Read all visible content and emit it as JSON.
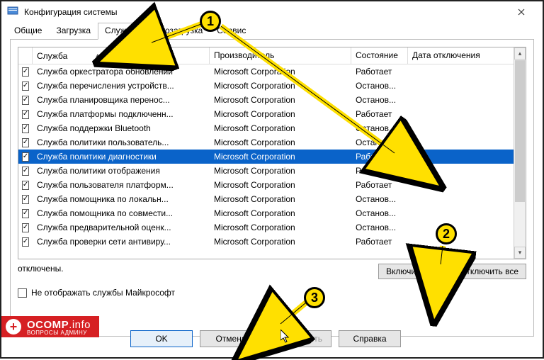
{
  "title": "Конфигурация системы",
  "tabs": [
    "Общие",
    "Загрузка",
    "Службы",
    "Автозагрузка",
    "Сервис"
  ],
  "active_tab": 2,
  "columns": {
    "name": "Служба",
    "vendor": "Производитель",
    "state": "Состояние",
    "date": "Дата отключения"
  },
  "rows": [
    {
      "checked": true,
      "name": "Служба оркестратора обновлений",
      "vendor": "Microsoft Corporation",
      "state": "Работает"
    },
    {
      "checked": true,
      "name": "Служба перечисления устройств...",
      "vendor": "Microsoft Corporation",
      "state": "Останов..."
    },
    {
      "checked": true,
      "name": "Служба планировщика перенос...",
      "vendor": "Microsoft Corporation",
      "state": "Останов..."
    },
    {
      "checked": true,
      "name": "Служба платформы подключенн...",
      "vendor": "Microsoft Corporation",
      "state": "Работает"
    },
    {
      "checked": true,
      "name": "Служба поддержки Bluetooth",
      "vendor": "Microsoft Corporation",
      "state": "Останов..."
    },
    {
      "checked": true,
      "name": "Служба политики пользователь...",
      "vendor": "Microsoft Corporation",
      "state": "Останов..."
    },
    {
      "checked": true,
      "name": "Служба политики диагностики",
      "vendor": "Microsoft Corporation",
      "state": "Работает",
      "selected": true
    },
    {
      "checked": true,
      "name": "Служба политики отображения",
      "vendor": "Microsoft Corporation",
      "state": "Работает"
    },
    {
      "checked": true,
      "name": "Служба пользователя платформ...",
      "vendor": "Microsoft Corporation",
      "state": "Работает"
    },
    {
      "checked": true,
      "name": "Служба помощника по локальн...",
      "vendor": "Microsoft Corporation",
      "state": "Останов..."
    },
    {
      "checked": true,
      "name": "Служба помощника по совмести...",
      "vendor": "Microsoft Corporation",
      "state": "Останов..."
    },
    {
      "checked": true,
      "name": "Служба предварительной оценк...",
      "vendor": "Microsoft Corporation",
      "state": "Останов..."
    },
    {
      "checked": true,
      "name": "Служба проверки сети антивиру...",
      "vendor": "Microsoft Corporation",
      "state": "Работает"
    }
  ],
  "note_line": "отключены.",
  "enable_all": "Включить все",
  "disable_all": "Отключить все",
  "hide_ms": "Не отображать службы Майкрософт",
  "buttons": {
    "ok": "OK",
    "cancel": "Отмена",
    "apply": "Применить",
    "help": "Справка"
  },
  "markers": [
    "1",
    "2",
    "3"
  ],
  "watermark": {
    "brand": "OCOMP",
    "suffix": ".info",
    "sub": "ВОПРОСЫ АДМИНУ"
  }
}
